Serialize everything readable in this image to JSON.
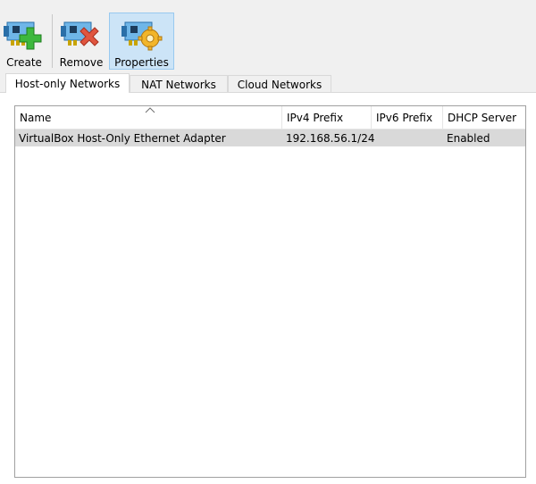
{
  "toolbar": {
    "create_label": "Create",
    "remove_label": "Remove",
    "properties_label": "Properties"
  },
  "tabs": [
    {
      "label": "Host-only Networks",
      "active": true
    },
    {
      "label": "NAT Networks",
      "active": false
    },
    {
      "label": "Cloud Networks",
      "active": false
    }
  ],
  "table": {
    "columns": [
      "Name",
      "IPv4 Prefix",
      "IPv6 Prefix",
      "DHCP Server"
    ],
    "sort_column": "Name",
    "rows": [
      {
        "name": "VirtualBox Host-Only Ethernet Adapter",
        "ipv4": "192.168.56.1/24",
        "ipv6": "",
        "dhcp": "Enabled"
      }
    ]
  },
  "colors": {
    "selected_tool_bg": "#cce4f7",
    "selected_row_bg": "#d9d9d9"
  }
}
